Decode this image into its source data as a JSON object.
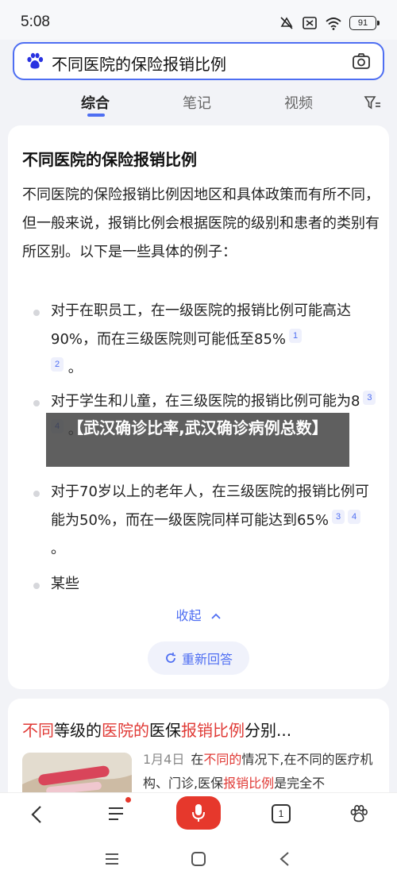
{
  "status": {
    "time": "5:08",
    "battery": "91"
  },
  "search": {
    "query": "不同医院的保险报销比例"
  },
  "tabs": [
    {
      "label": "综合",
      "active": true
    },
    {
      "label": "笔记",
      "active": false
    },
    {
      "label": "视频",
      "active": false
    }
  ],
  "answer": {
    "title": "不同医院的保险报销比例",
    "intro": "不同医院的保险报销比例因地区和具体政策而有所不同，但一般来说，报销比例会根据医院的级别和患者的类别有所区别。以下是一些具体的例子：",
    "bullets": [
      {
        "text": "对于在职员工，在一级医院的报销比例可能高达90%，而在三级医院则可能低至85%",
        "cites": [
          "1",
          "2"
        ],
        "tail": "。"
      },
      {
        "text": "对于学生和儿童，在三级医院的报销比例可能为8",
        "cites": [
          "3",
          "4"
        ],
        "tail": "。"
      },
      {
        "text": "对于70岁以上的老年人，在三级医院的报销比例可能为50%，而在一级医院同样可能达到65%",
        "cites": [
          "3",
          "4"
        ],
        "tail": "。"
      },
      {
        "text": "某些",
        "cites": [],
        "tail": ""
      }
    ],
    "collapse_label": "收起",
    "regenerate_label": "重新回答"
  },
  "overlay": {
    "text": "【武汉确诊比率,武汉确诊病例总数】"
  },
  "result2": {
    "title_parts": [
      {
        "text": "不同",
        "highlight": true
      },
      {
        "text": "等级的",
        "highlight": false
      },
      {
        "text": "医院的",
        "highlight": true
      },
      {
        "text": "医保",
        "highlight": false
      },
      {
        "text": "报销比例",
        "highlight": true
      },
      {
        "text": "分别...",
        "highlight": false
      }
    ],
    "date": "1月4日",
    "snippet_parts": [
      {
        "text": "在",
        "highlight": false
      },
      {
        "text": "不同的",
        "highlight": true
      },
      {
        "text": "情况下,在不同的医疗机构、门诊,医保",
        "highlight": false
      },
      {
        "text": "报销比例",
        "highlight": true
      },
      {
        "text": "是完全不",
        "highlight": false
      }
    ]
  },
  "bottom_nav": {
    "tab_count": "1"
  },
  "colors": {
    "accent": "#4e6ef2",
    "highlight": "#e03a36",
    "mic": "#e6382c"
  }
}
